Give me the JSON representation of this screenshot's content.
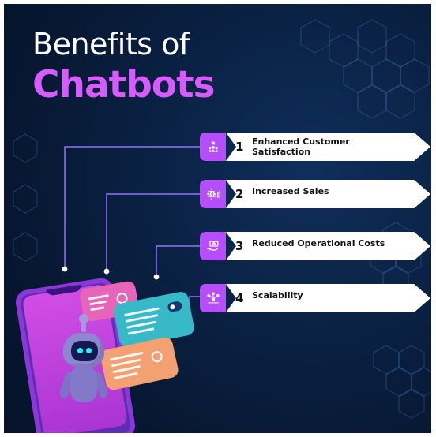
{
  "header": {
    "title_line1": "Benefits of",
    "title_line2": "Chatbots"
  },
  "colors": {
    "background": "#0b2347",
    "accent_purple": "#b64dff",
    "title_purple": "#d65cff",
    "text_dark": "#111111",
    "white": "#ffffff"
  },
  "benefits": [
    {
      "number": "1",
      "label": "Enhanced Customer Satisfaction",
      "icon": "star-people-icon"
    },
    {
      "number": "2",
      "label": "Increased Sales",
      "icon": "chart-gear-icon"
    },
    {
      "number": "3",
      "label": "Reduced Operational Costs",
      "icon": "money-hand-icon"
    },
    {
      "number": "4",
      "label": "Scalability",
      "icon": "network-scale-icon"
    }
  ],
  "illustration": {
    "phone_icon": "phone-icon",
    "robot_icon": "robot-icon",
    "bubble_icons": [
      "chat-bubble-icon",
      "chat-bubble-icon",
      "chat-bubble-icon"
    ]
  }
}
